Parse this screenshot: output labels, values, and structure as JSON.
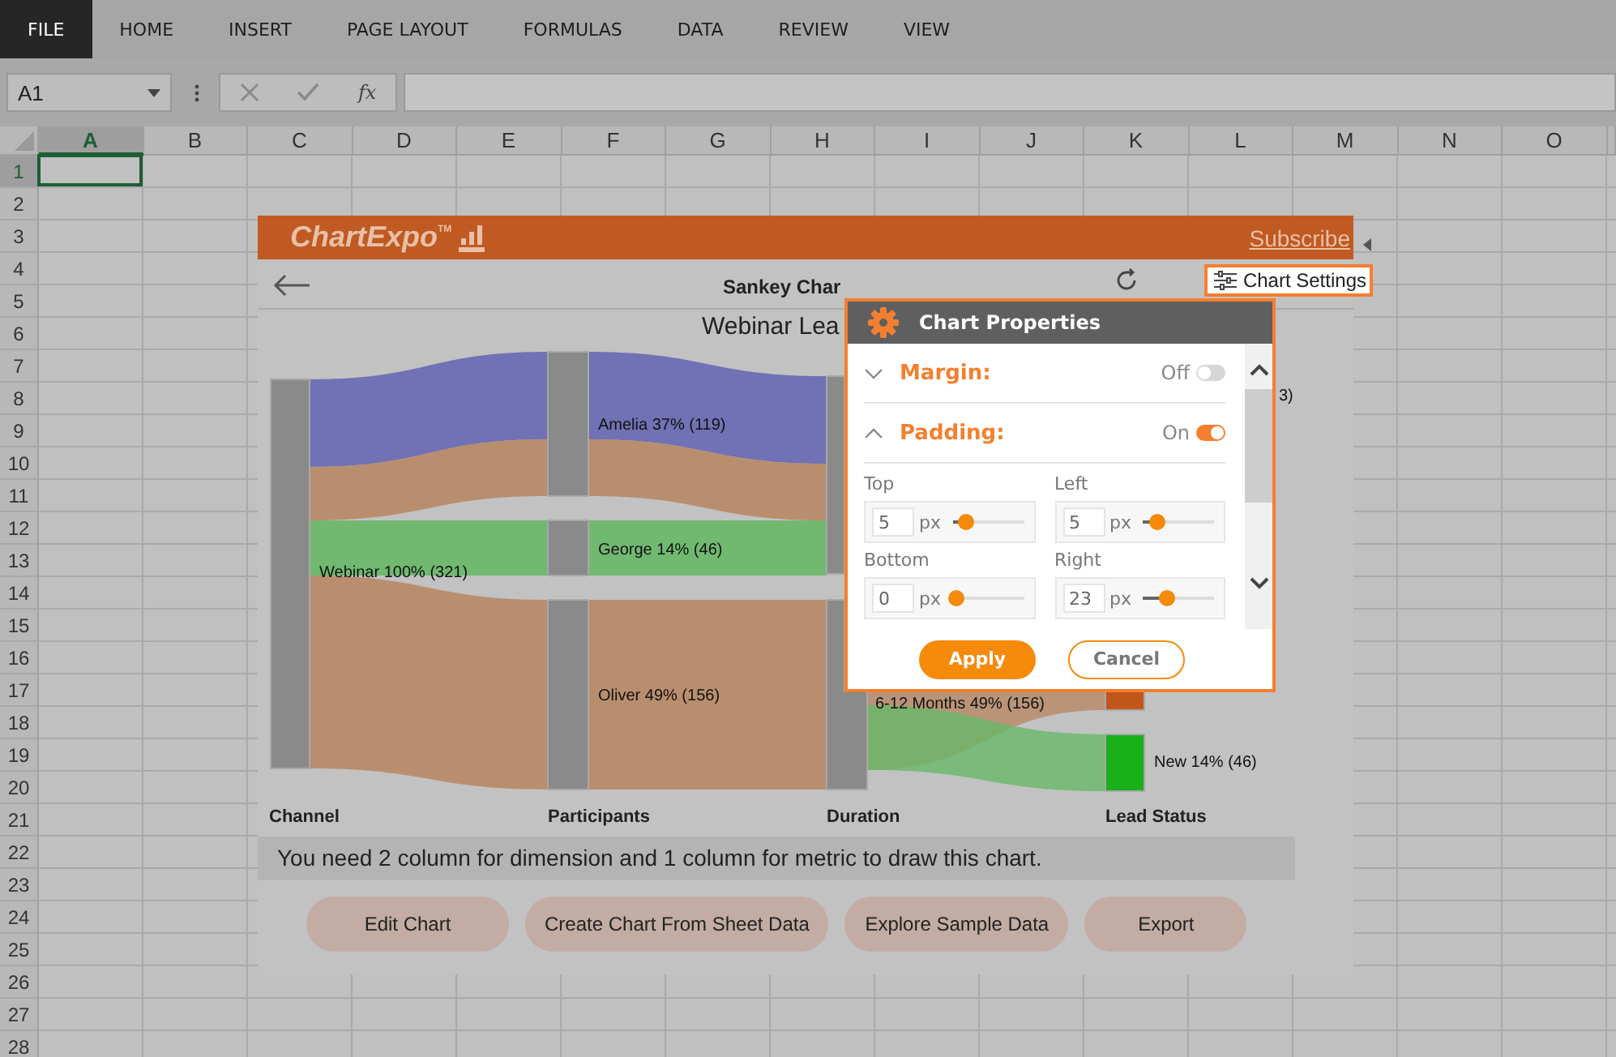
{
  "ribbon": {
    "tabs": [
      {
        "label": "FILE",
        "selected": true
      },
      {
        "label": "HOME",
        "selected": false
      },
      {
        "label": "INSERT",
        "selected": false
      },
      {
        "label": "PAGE LAYOUT",
        "selected": false
      },
      {
        "label": "FORMULAS",
        "selected": false
      },
      {
        "label": "DATA",
        "selected": false
      },
      {
        "label": "REVIEW",
        "selected": false
      },
      {
        "label": "VIEW",
        "selected": false
      }
    ]
  },
  "formula_bar": {
    "name_box": "A1",
    "function_button": "fx"
  },
  "sheet": {
    "columns": [
      {
        "label": "A",
        "selected": true
      },
      {
        "label": "B",
        "selected": false
      },
      {
        "label": "C",
        "selected": false
      },
      {
        "label": "D",
        "selected": false
      },
      {
        "label": "E",
        "selected": false
      },
      {
        "label": "F",
        "selected": false
      },
      {
        "label": "G",
        "selected": false
      },
      {
        "label": "H",
        "selected": false
      },
      {
        "label": "I",
        "selected": false
      },
      {
        "label": "J",
        "selected": false
      },
      {
        "label": "K",
        "selected": false
      },
      {
        "label": "L",
        "selected": false
      },
      {
        "label": "M",
        "selected": false
      },
      {
        "label": "N",
        "selected": false
      },
      {
        "label": "O",
        "selected": false
      }
    ],
    "rows": [
      {
        "label": "1",
        "selected": true
      },
      {
        "label": "2",
        "selected": false
      },
      {
        "label": "3",
        "selected": false
      },
      {
        "label": "4",
        "selected": false
      },
      {
        "label": "5",
        "selected": false
      },
      {
        "label": "6",
        "selected": false
      },
      {
        "label": "7",
        "selected": false
      },
      {
        "label": "8",
        "selected": false
      },
      {
        "label": "9",
        "selected": false
      },
      {
        "label": "10",
        "selected": false
      },
      {
        "label": "11",
        "selected": false
      },
      {
        "label": "12",
        "selected": false
      },
      {
        "label": "13",
        "selected": false
      },
      {
        "label": "14",
        "selected": false
      },
      {
        "label": "15",
        "selected": false
      },
      {
        "label": "16",
        "selected": false
      },
      {
        "label": "17",
        "selected": false
      },
      {
        "label": "18",
        "selected": false
      },
      {
        "label": "19",
        "selected": false
      },
      {
        "label": "20",
        "selected": false
      },
      {
        "label": "21",
        "selected": false
      },
      {
        "label": "22",
        "selected": false
      },
      {
        "label": "23",
        "selected": false
      },
      {
        "label": "24",
        "selected": false
      },
      {
        "label": "25",
        "selected": false
      },
      {
        "label": "26",
        "selected": false
      },
      {
        "label": "27",
        "selected": false
      },
      {
        "label": "28",
        "selected": false
      }
    ]
  },
  "addin": {
    "brand": "ChartExpo",
    "brand_mark": "TM",
    "subscribe": "Subscribe",
    "chart_type": "Sankey Char",
    "settings_button": "Chart Settings",
    "chart": {
      "title": "Webinar Lea",
      "node_labels": [
        "Webinar 100% (321)",
        "Amelia 37% (119)",
        "George 14% (46)",
        "Oliver 49% (156)",
        "6-12 Months 49% (156)",
        "3)",
        "New 14% (46)"
      ],
      "axis_labels": [
        "Channel",
        "Participants",
        "Duration",
        "Lead Status"
      ]
    },
    "message": "You need 2 column for dimension and 1 column for metric to draw this chart.",
    "buttons": [
      "Edit Chart",
      "Create Chart From Sheet Data",
      "Explore Sample Data",
      "Export"
    ]
  },
  "dialog": {
    "title": "Chart Properties",
    "sections": [
      {
        "label": "Margin:",
        "state_text": "Off",
        "expanded": false,
        "on": false
      },
      {
        "label": "Padding:",
        "state_text": "On",
        "expanded": true,
        "on": true
      }
    ],
    "fields": [
      {
        "label": "Top",
        "value": "5",
        "unit": "px",
        "level": 0.2
      },
      {
        "label": "Left",
        "value": "5",
        "unit": "px",
        "level": 0.2
      },
      {
        "label": "Bottom",
        "value": "0",
        "unit": "px",
        "level": 0.05
      },
      {
        "label": "Right",
        "value": "23",
        "unit": "px",
        "level": 0.35
      }
    ],
    "buttons": [
      {
        "label": "Apply",
        "kind": "primary"
      },
      {
        "label": "Cancel",
        "kind": "secondary"
      }
    ]
  }
}
